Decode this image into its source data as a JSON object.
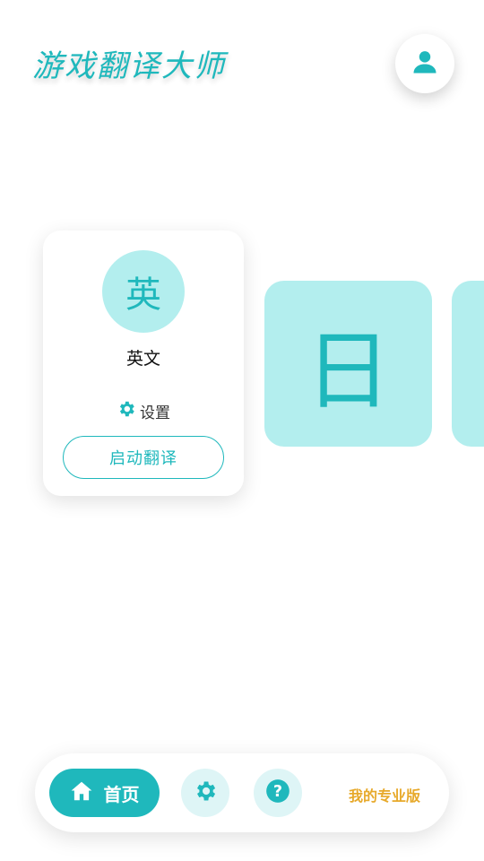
{
  "header": {
    "title": "游戏翻译大师",
    "profile_icon": "user-icon"
  },
  "languages": {
    "active": {
      "symbol": "英",
      "name": "英文",
      "settings_label": "设置",
      "settings_icon": "gear-icon",
      "start_label": "启动翻译"
    },
    "next": {
      "symbol": "日"
    }
  },
  "bottom_nav": {
    "home_label": "首页",
    "home_icon": "home-icon",
    "settings_icon": "gear-icon",
    "help_icon": "question-icon",
    "pro_label": "我的专业版"
  },
  "colors": {
    "accent": "#1fb8bc",
    "accent_light": "#b3eeee",
    "pro": "#e7a92a"
  }
}
